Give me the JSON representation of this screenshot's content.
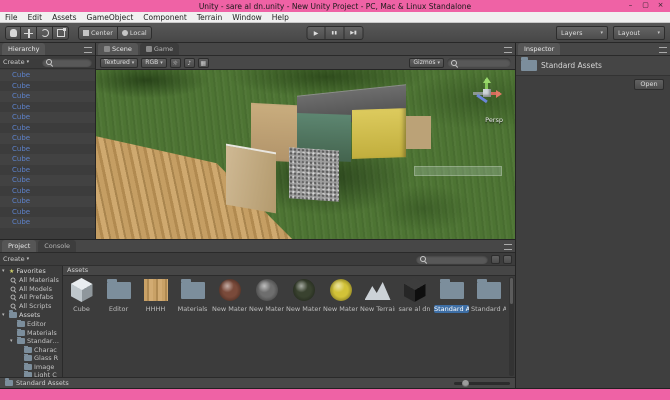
{
  "window": {
    "title": "Unity - sare al dn.unity - New Unity Project - PC, Mac & Linux Standalone",
    "minimize_glyph": "–",
    "maximize_glyph": "▢",
    "close_glyph": "×"
  },
  "colors": {
    "titlebar_pink": "#ef62a5",
    "selection_blue": "#3d6ea5",
    "hierarchy_item_blue": "#5d81c9",
    "panel_background": "#3c3c3c"
  },
  "menubar": {
    "items": [
      "File",
      "Edit",
      "Assets",
      "GameObject",
      "Component",
      "Terrain",
      "Window",
      "Help"
    ]
  },
  "toolbar": {
    "pivot_label": "Center",
    "space_label": "Local",
    "play_glyph": "▶",
    "pause_glyph": "▮▮",
    "step_glyph": "▶▮",
    "layers_label": "Layers",
    "layout_label": "Layout",
    "dropdown_arrow": "▾"
  },
  "hierarchy": {
    "tab_label": "Hierarchy",
    "create_label": "Create",
    "items": [
      "Cube",
      "Cube",
      "Cube",
      "Cube",
      "Cube",
      "Cube",
      "Cube",
      "Cube",
      "Cube",
      "Cube",
      "Cube",
      "Cube",
      "Cube",
      "Cube",
      "Cube"
    ]
  },
  "scene": {
    "tabs": [
      {
        "label": "Scene",
        "selected": true
      },
      {
        "label": "Game",
        "selected": false
      }
    ],
    "draw_mode_label": "Textured",
    "channels_label": "RGB",
    "light_glyph": "☼",
    "audio_glyph": "♪",
    "fx_glyph": "▦",
    "gizmos_label": "Gizmos",
    "persp_label": "Persp"
  },
  "inspector": {
    "tab_label": "Inspector",
    "asset_name": "Standard Assets",
    "open_label": "Open"
  },
  "project": {
    "tabs": [
      {
        "label": "Project",
        "selected": true
      },
      {
        "label": "Console",
        "selected": false
      }
    ],
    "create_label": "Create",
    "expanded_arrow": "▾",
    "star_glyph": "★",
    "favorites_label": "Favorites",
    "favorites": [
      "All Materials",
      "All Models",
      "All Prefabs",
      "All Scripts"
    ],
    "assets_label": "Assets",
    "tree": [
      {
        "label": "Editor",
        "indent": 10
      },
      {
        "label": "Materials",
        "indent": 10
      },
      {
        "label": "Standard Assets",
        "indent": 10,
        "arrow": "▾"
      },
      {
        "label": "Charac",
        "indent": 17
      },
      {
        "label": "Glass R",
        "indent": 17
      },
      {
        "label": "Image",
        "indent": 17
      },
      {
        "label": "Light C",
        "indent": 17
      }
    ],
    "grid_header": "Assets",
    "grid_items": [
      {
        "label": "Cube",
        "type": "cube"
      },
      {
        "label": "Editor",
        "type": "folder"
      },
      {
        "label": "HHHH",
        "type": "texture"
      },
      {
        "label": "Materials",
        "type": "folder"
      },
      {
        "label": "New Mater...",
        "type": "material",
        "color": "#7a4a3a"
      },
      {
        "label": "New Mater...",
        "type": "material",
        "color": "#6e6e6e"
      },
      {
        "label": "New Mater...",
        "type": "material",
        "color": "#39422f"
      },
      {
        "label": "New Mater...",
        "type": "material",
        "color": "#d2c238"
      },
      {
        "label": "New Terrain",
        "type": "terrain"
      },
      {
        "label": "sare al dn",
        "type": "unity"
      },
      {
        "label": "Standard A...",
        "type": "folder",
        "selected": true
      },
      {
        "label": "Standard A...",
        "type": "folder"
      }
    ],
    "footer_path": "Standard Assets"
  }
}
